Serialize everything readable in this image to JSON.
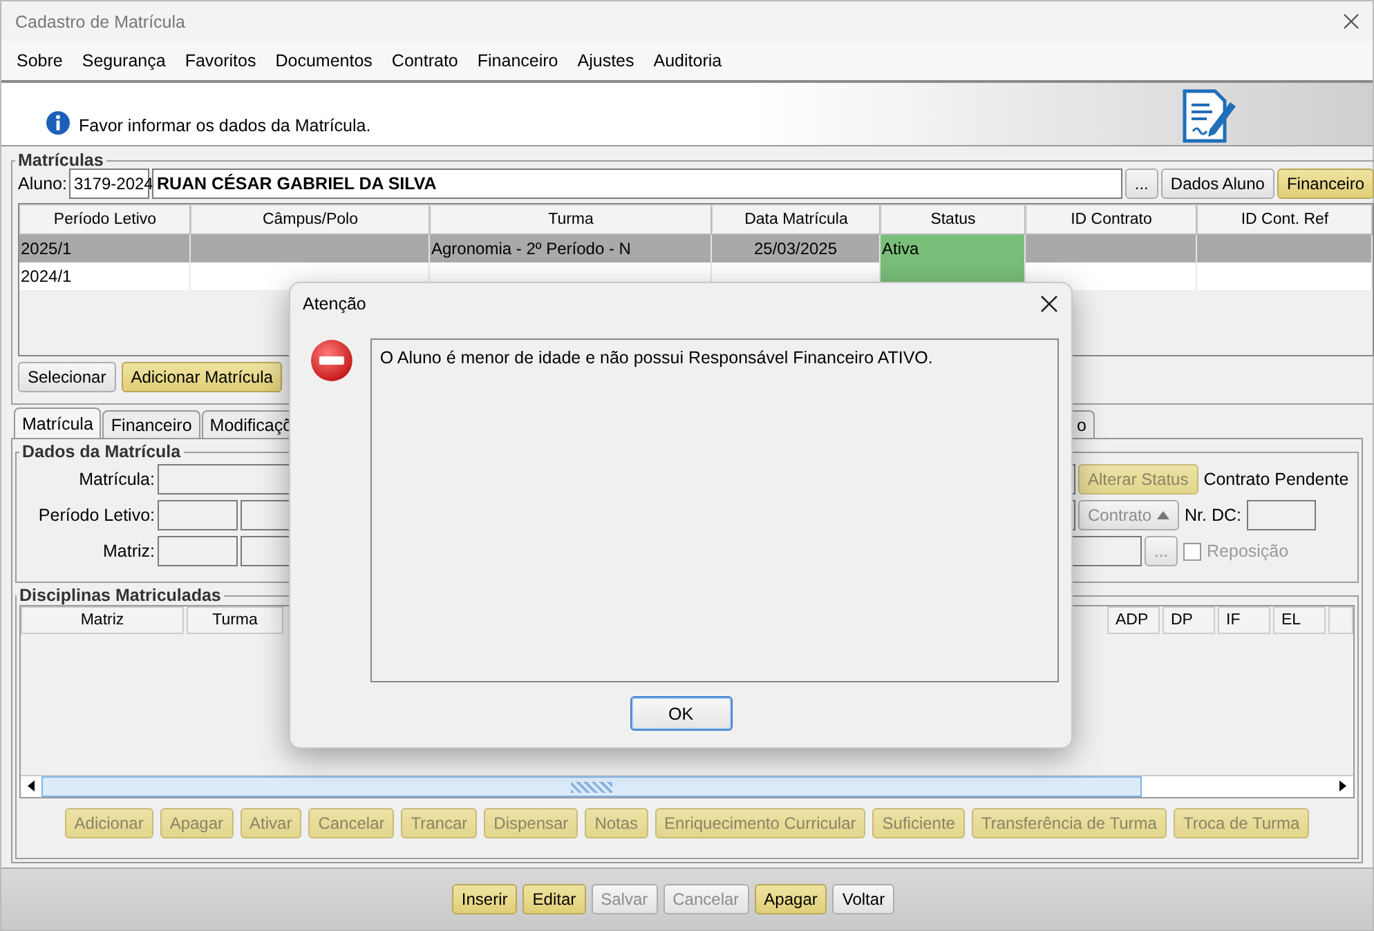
{
  "window": {
    "title": "Cadastro de Matrícula"
  },
  "menu": [
    "Sobre",
    "Segurança",
    "Favoritos",
    "Documentos",
    "Contrato",
    "Financeiro",
    "Ajustes",
    "Auditoria"
  ],
  "banner": {
    "message": "Favor informar os dados da Matrícula."
  },
  "matriculas": {
    "title": "Matrículas",
    "aluno_label": "Aluno:",
    "aluno_code": "3179-2024",
    "aluno_name": "RUAN CÉSAR GABRIEL DA SILVA",
    "buttons": [
      {
        "label": "...",
        "highlighted": false
      },
      {
        "label": "Dados Aluno",
        "highlighted": false
      },
      {
        "label": "Financeiro",
        "highlighted": true
      }
    ],
    "table": {
      "columns": [
        "Período Letivo",
        "Câmpus/Polo",
        "Turma",
        "Data Matrícula",
        "Status",
        "ID Contrato",
        "ID Cont. Ref"
      ],
      "rows": [
        {
          "selected": true,
          "active": true,
          "periodo": "2025/1",
          "turma": "Agronomia - 2º Período - N",
          "data": "25/03/2025",
          "status": "Ativa"
        },
        {
          "selected": false,
          "active": true,
          "periodo": "2024/1"
        }
      ]
    },
    "row_buttons": [
      {
        "label": "Selecionar",
        "highlighted": false
      },
      {
        "label": "Adicionar Matrícula",
        "highlighted": true
      }
    ]
  },
  "tabs": [
    {
      "label": "Matrícula",
      "selected": true
    },
    {
      "label": "Financeiro",
      "selected": false
    },
    {
      "label": "Modificaçõ",
      "selected": false
    },
    {
      "label": "o",
      "selected": false
    }
  ],
  "dados": {
    "title": "Dados da Matrícula",
    "labels": [
      "Matrícula:",
      "Período Letivo:",
      "Matriz:"
    ],
    "alterar_status": {
      "label": "Alterar Status",
      "highlighted": true,
      "disabled": true
    },
    "contrato_status": "Contrato Pendente",
    "contrato_button": {
      "label": "Contrato",
      "disabled": true
    },
    "nr_dc_label": "Nr. DC:",
    "browse_button": {
      "label": "...",
      "disabled": true
    },
    "reposicao": {
      "label": "Reposição",
      "checked": false,
      "disabled": true
    }
  },
  "disciplinas": {
    "title": "Disciplinas Matriculadas",
    "left_columns": [
      "Matriz",
      "Turma"
    ],
    "right_columns": [
      "ADP",
      "DP",
      "IF",
      "EL"
    ],
    "buttons": [
      {
        "label": "Adicionar",
        "highlighted": true,
        "disabled": true
      },
      {
        "label": "Apagar",
        "highlighted": true,
        "disabled": true
      },
      {
        "label": "Ativar",
        "highlighted": true,
        "disabled": true
      },
      {
        "label": "Cancelar",
        "highlighted": true,
        "disabled": true
      },
      {
        "label": "Trancar",
        "highlighted": true,
        "disabled": true
      },
      {
        "label": "Dispensar",
        "highlighted": true,
        "disabled": true
      },
      {
        "label": "Notas",
        "highlighted": true,
        "disabled": true
      },
      {
        "label": "Enriquecimento Curricular",
        "highlighted": true,
        "disabled": true
      },
      {
        "label": "Suficiente",
        "highlighted": true,
        "disabled": true
      },
      {
        "label": "Transferência de Turma",
        "highlighted": true,
        "disabled": true
      },
      {
        "label": "Troca de Turma",
        "highlighted": true,
        "disabled": true
      }
    ]
  },
  "footer_buttons": [
    {
      "label": "Inserir",
      "highlighted": true,
      "disabled": false
    },
    {
      "label": "Editar",
      "highlighted": true,
      "disabled": false
    },
    {
      "label": "Salvar",
      "highlighted": false,
      "disabled": true
    },
    {
      "label": "Cancelar",
      "highlighted": false,
      "disabled": true
    },
    {
      "label": "Apagar",
      "highlighted": true,
      "disabled": false
    },
    {
      "label": "Voltar",
      "highlighted": false,
      "disabled": false
    }
  ],
  "dialog": {
    "title": "Atenção",
    "message": "O Aluno é menor de idade e não possui Responsável Financeiro ATIVO.",
    "button": "OK"
  }
}
